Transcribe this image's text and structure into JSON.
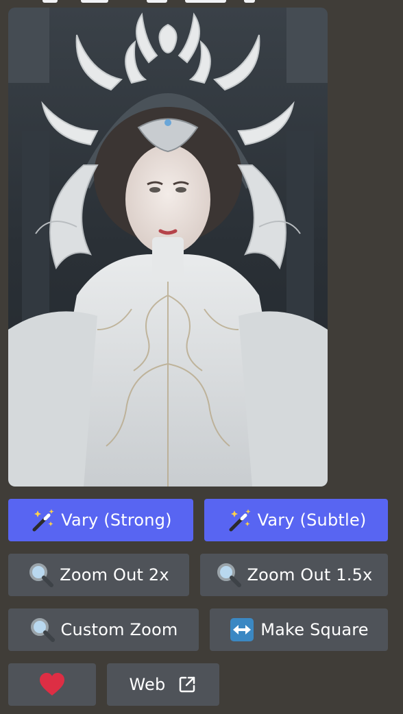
{
  "message": {
    "image": {
      "alt": "Portrait of a woman in an ornate white porcelain-like gown with a white filigree crown"
    },
    "buttons": {
      "vary_strong": {
        "label": "Vary (Strong)",
        "icon": "magic-wand-icon"
      },
      "vary_subtle": {
        "label": "Vary (Subtle)",
        "icon": "magic-wand-icon"
      },
      "zoom_out_2x": {
        "label": "Zoom Out 2x",
        "icon": "magnifying-glass-icon"
      },
      "zoom_out_1_5x": {
        "label": "Zoom Out 1.5x",
        "icon": "magnifying-glass-icon"
      },
      "custom_zoom": {
        "label": "Custom Zoom",
        "icon": "magnifying-glass-icon"
      },
      "make_square": {
        "label": "Make Square",
        "icon": "left-right-arrow-icon"
      },
      "favorite": {
        "label": "",
        "icon": "heart-icon"
      },
      "web": {
        "label": "Web",
        "icon": "external-link-icon"
      }
    }
  },
  "colors": {
    "background": "#403d38",
    "primary_button": "#5865f2",
    "secondary_button": "#4f5359",
    "button_text": "#ffffff",
    "heart": "#dd2e44",
    "arrow_tile": "#3b88c3"
  }
}
